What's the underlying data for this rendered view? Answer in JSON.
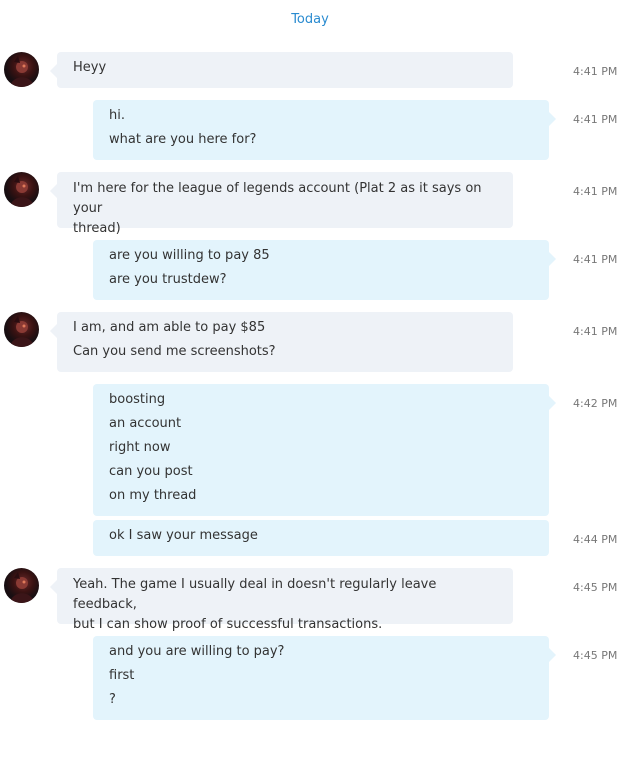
{
  "date_separator": "Today",
  "colors": {
    "accent": "#2a8bd0",
    "incoming_bubble": "#eef2f7",
    "outgoing_bubble": "#e3f4fc",
    "timestamp": "#777777"
  },
  "icons": {
    "avatar": "contact-avatar"
  },
  "messages": [
    {
      "direction": "incoming",
      "time": "4:41 PM",
      "lines": [
        "Heyy"
      ]
    },
    {
      "direction": "outgoing",
      "time": "4:41 PM",
      "lines": [
        "hi.",
        "what are you here for?"
      ]
    },
    {
      "direction": "incoming",
      "time": "4:41 PM",
      "lines": [
        "I'm here for the league of legends account (Plat 2 as it says on your",
        "thread)"
      ]
    },
    {
      "direction": "outgoing",
      "time": "4:41 PM",
      "lines": [
        "are you willing to pay 85",
        "are you trustdew?"
      ]
    },
    {
      "direction": "incoming",
      "time": "4:41 PM",
      "lines": [
        "I am, and am able to pay $85",
        "Can you send me screenshots?"
      ]
    },
    {
      "direction": "outgoing",
      "time": "4:42 PM",
      "lines": [
        "boosting",
        "an account",
        "right now",
        "can you post",
        "on my thread"
      ]
    },
    {
      "direction": "outgoing",
      "time": "4:44 PM",
      "lines": [
        "ok I saw your message"
      ]
    },
    {
      "direction": "incoming",
      "time": "4:45 PM",
      "lines": [
        "Yeah. The game I usually deal in doesn't regularly leave feedback,",
        "but I can show proof of successful transactions."
      ]
    },
    {
      "direction": "outgoing",
      "time": "4:45 PM",
      "lines": [
        "and you are willing to pay?",
        "first",
        "?"
      ]
    }
  ]
}
